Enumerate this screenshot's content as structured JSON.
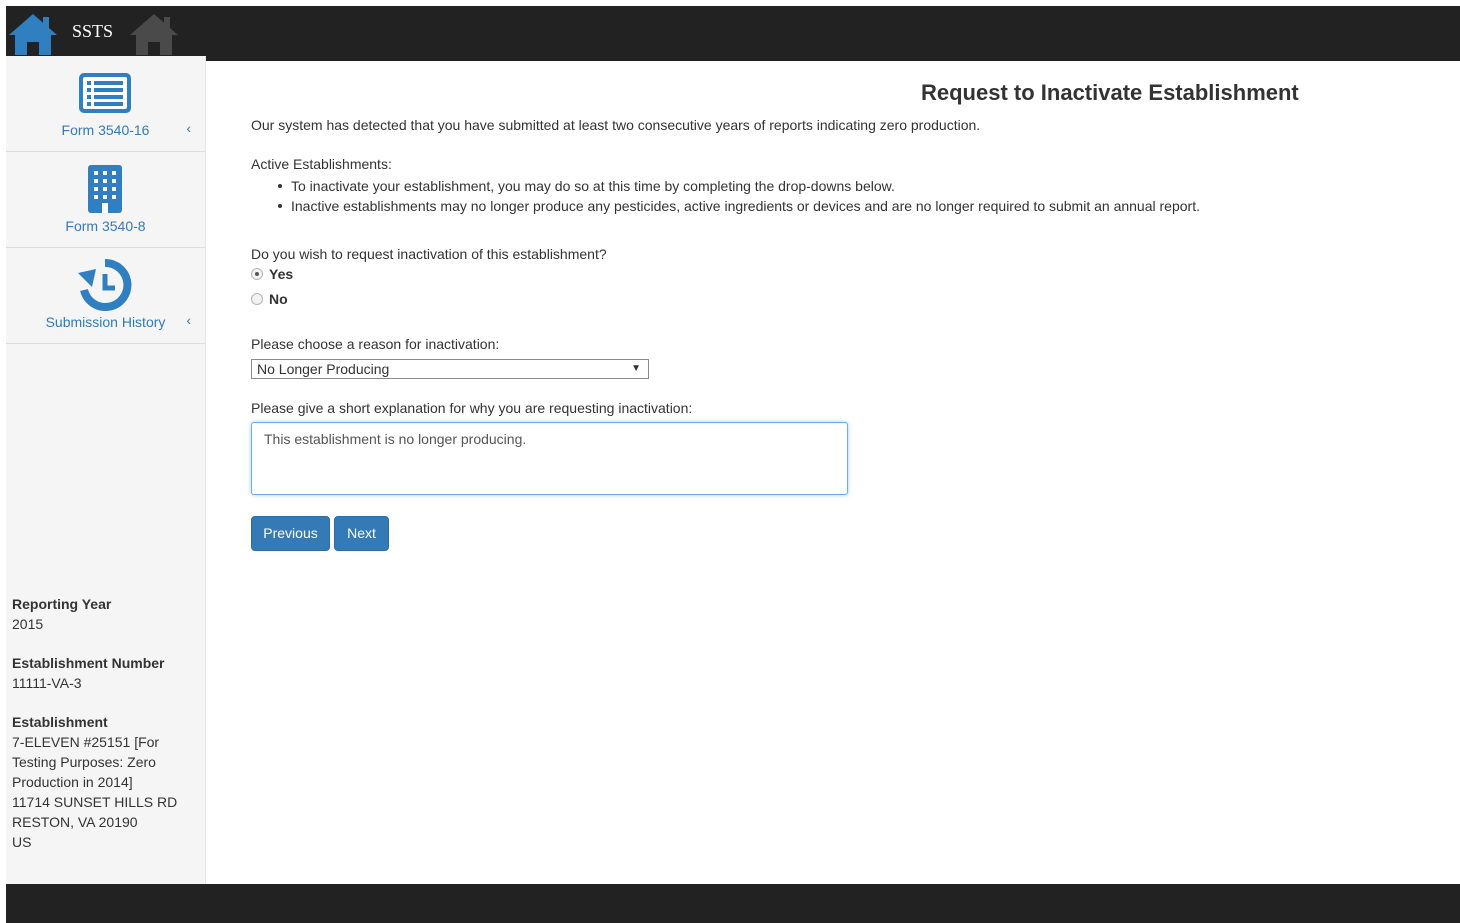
{
  "brand": "SSTS",
  "sidebar": {
    "items": [
      {
        "label": "Form 3540-16",
        "icon": "list-form-icon",
        "chevron": "‹"
      },
      {
        "label": "Form 3540-8",
        "icon": "building-icon",
        "chevron": ""
      },
      {
        "label": "Submission History",
        "icon": "history-icon",
        "chevron": "‹"
      }
    ],
    "info": {
      "year_label": "Reporting Year",
      "year_value": "2015",
      "number_label": "Establishment Number",
      "number_value": "11111-VA-3",
      "est_label": "Establishment",
      "est_lines": [
        "7-ELEVEN #25151 [For",
        "Testing Purposes: Zero",
        "Production in 2014]",
        "11714 SUNSET HILLS RD",
        "RESTON, VA 20190",
        "US"
      ]
    }
  },
  "main": {
    "title": "Request to Inactivate Establishment",
    "intro": "Our system has detected that you have submitted at least two consecutive years of reports indicating zero production.",
    "active_heading": "Active Establishments:",
    "bullets": [
      "To inactivate your establishment, you may do so at this time by completing the drop-downs below.",
      "Inactive establishments may no longer produce any pesticides, active ingredients or devices and are no longer required to submit an annual report."
    ],
    "question": "Do you wish to request inactivation of this establishment?",
    "yes_label": "Yes",
    "no_label": "No",
    "reason_label": "Please choose a reason for inactivation:",
    "reason_value": "No Longer Producing",
    "explanation_label": "Please give a short explanation for why you are requesting inactivation:",
    "explanation_value": "This establishment is no longer producing.",
    "previous_label": "Previous",
    "next_label": "Next"
  },
  "colors": {
    "accent": "#337ab7",
    "topbar": "#222222",
    "sidebar": "#f5f5f5"
  }
}
